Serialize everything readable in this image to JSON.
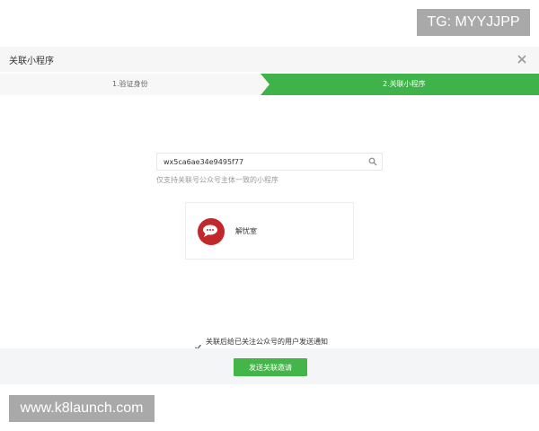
{
  "watermarks": {
    "top_right": "TG: MYYJJPP",
    "bottom_left": "www.k8launch.com"
  },
  "dialog": {
    "title": "关联小程序",
    "close_icon": "close-icon"
  },
  "steps": [
    {
      "label": "1.验证身份",
      "active": false
    },
    {
      "label": "2.关联小程序",
      "active": true
    }
  ],
  "search": {
    "value": "wx5ca6ae34e9495f77",
    "icon": "search-icon",
    "hint": "仅支持关联号公众号主体一致的小程序"
  },
  "result": {
    "app_name": "解忧室",
    "avatar_icon": "chat-bubble-avatar"
  },
  "agreement": {
    "checked": true,
    "text": "关联后给已关注公众号的用户发送通知"
  },
  "footer": {
    "submit_label": "发送关联邀请"
  },
  "colors": {
    "accent_green": "#44b549",
    "avatar_red": "#c0282d"
  }
}
